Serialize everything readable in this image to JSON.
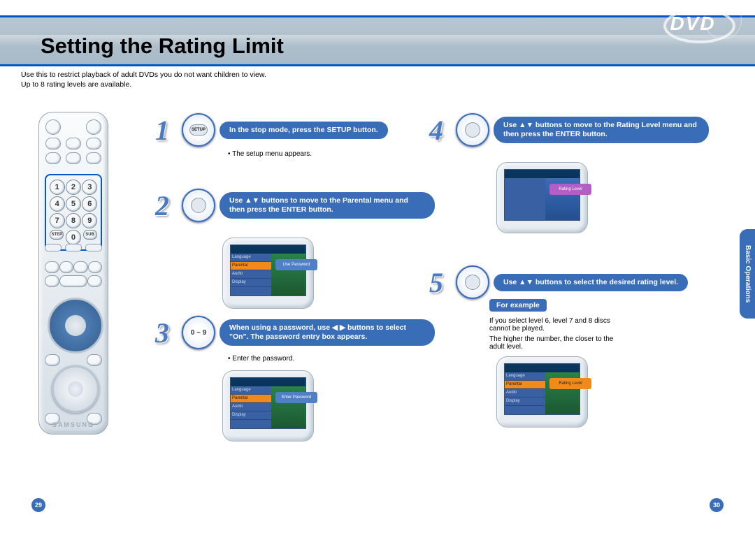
{
  "title": "Setting the Rating Limit",
  "intro_line1": "Use this to restrict playback of adult DVDs you do not want children to view.",
  "intro_line2": "Up to 8 rating levels are available.",
  "dvd_logo": "DVD",
  "remote": {
    "keys": [
      "1",
      "2",
      "3",
      "4",
      "5",
      "6",
      "7",
      "8",
      "9",
      "0"
    ],
    "small_left": "STEP",
    "small_right": "SUB",
    "brand": "SAMSUNG"
  },
  "steps": {
    "1": {
      "btn": "SETUP",
      "text": "In the stop mode, press the SETUP button.",
      "note": "• The setup menu appears."
    },
    "2": {
      "text": "Use ▲▼ buttons to move to the Parental menu and then press the ENTER button."
    },
    "3": {
      "btn": "0 ~ 9",
      "text": "When using a password, use ◀ ▶ buttons to select \"On\". The password entry box appears.",
      "note": "• Enter the password."
    },
    "4": {
      "text": "Use ▲▼ buttons to move to the Rating Level menu and then press the ENTER button."
    },
    "5": {
      "text": "Use ▲▼ buttons to select the desired rating level.",
      "example_label": "For example",
      "example_text1": "If you select level 6, level 7 and 8 discs cannot be played.",
      "example_text2": "The higher the number, the closer to the adult level."
    }
  },
  "osd_menu": {
    "items": [
      "Language",
      "Parental",
      "Audio",
      "Display"
    ],
    "btn1": "Use Password",
    "btn2": "Enter Password",
    "btn3": "Rating Level"
  },
  "side_tab": "Basic Operations",
  "page_left": "29",
  "page_right": "30"
}
